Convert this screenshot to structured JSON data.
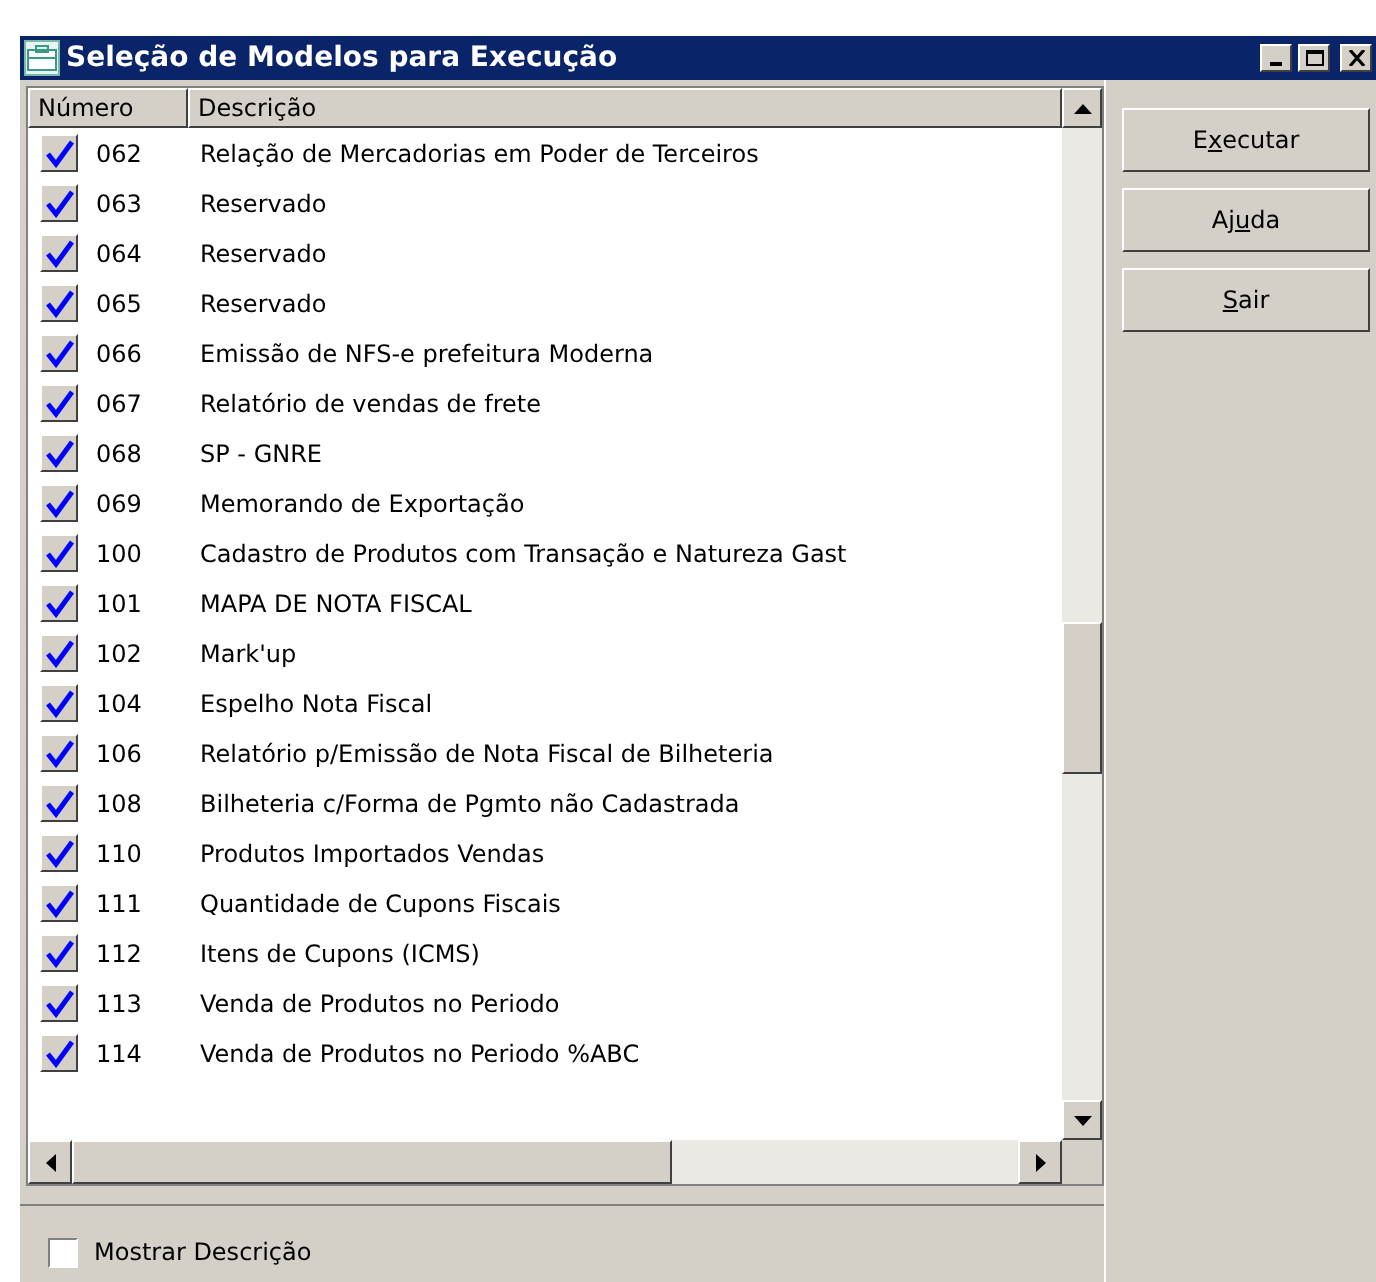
{
  "window": {
    "title": "Seleção de Modelos para Execução"
  },
  "table": {
    "columns": [
      "Número",
      "Descrição"
    ],
    "rows": [
      {
        "checked": true,
        "number": "062",
        "description": "Relação de Mercadorias em Poder de Terceiros"
      },
      {
        "checked": true,
        "number": "063",
        "description": "Reservado"
      },
      {
        "checked": true,
        "number": "064",
        "description": "Reservado"
      },
      {
        "checked": true,
        "number": "065",
        "description": "Reservado"
      },
      {
        "checked": true,
        "number": "066",
        "description": "Emissão de NFS-e prefeitura Moderna"
      },
      {
        "checked": true,
        "number": "067",
        "description": "Relatório de vendas de frete"
      },
      {
        "checked": true,
        "number": "068",
        "description": "SP - GNRE"
      },
      {
        "checked": true,
        "number": "069",
        "description": "Memorando de Exportação"
      },
      {
        "checked": true,
        "number": "100",
        "description": "Cadastro de Produtos com Transação e Natureza Gast"
      },
      {
        "checked": true,
        "number": "101",
        "description": "MAPA DE NOTA FISCAL"
      },
      {
        "checked": true,
        "number": "102",
        "description": "Mark'up"
      },
      {
        "checked": true,
        "number": "104",
        "description": "Espelho Nota Fiscal"
      },
      {
        "checked": true,
        "number": "106",
        "description": "Relatório p/Emissão de Nota Fiscal de Bilheteria"
      },
      {
        "checked": true,
        "number": "108",
        "description": "Bilheteria c/Forma de Pgmto não Cadastrada"
      },
      {
        "checked": true,
        "number": "110",
        "description": "Produtos Importados Vendas"
      },
      {
        "checked": true,
        "number": "111",
        "description": "Quantidade de Cupons Fiscais"
      },
      {
        "checked": true,
        "number": "112",
        "description": "Itens de Cupons (ICMS)"
      },
      {
        "checked": true,
        "number": "113",
        "description": "Venda de Produtos no Periodo"
      },
      {
        "checked": true,
        "number": "114",
        "description": "Venda de Produtos no Periodo %ABC"
      }
    ]
  },
  "show_description": {
    "label": "Mostrar Descrição",
    "checked": false
  },
  "buttons": [
    {
      "before": "E",
      "key": "x",
      "after": "ecutar"
    },
    {
      "before": "Aj",
      "key": "u",
      "after": "da"
    },
    {
      "key": "S",
      "after": "air"
    }
  ]
}
